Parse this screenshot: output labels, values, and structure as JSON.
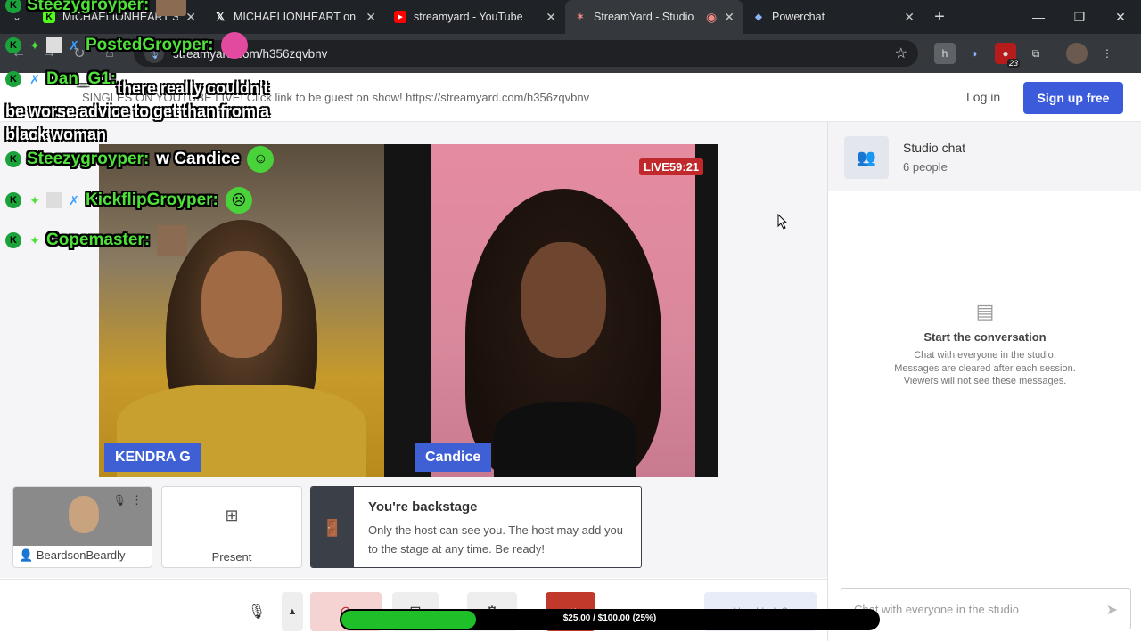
{
  "browser": {
    "tabs": [
      {
        "title": "MICHAELIONHEART Stre",
        "icon": "kick-icon",
        "color": "#53fc18"
      },
      {
        "title": "MICHAELIONHEART on X",
        "icon": "x-icon",
        "color": "#ffffff"
      },
      {
        "title": "streamyard - YouTube",
        "icon": "youtube-icon",
        "color": "#ff0000"
      },
      {
        "title": "StreamYard - Studio",
        "icon": "streamyard-icon",
        "color": "#f28b82",
        "active": true
      },
      {
        "title": "Powerchat",
        "icon": "powerchat-icon",
        "color": "#8ab4f8"
      }
    ],
    "url": "streamyard.com/h356zqvbnv"
  },
  "header": {
    "banner": "SINGLES ON YOUTUBE LIVE! Click link to be guest on show! https://streamyard.com/h356zqvbnv",
    "login": "Log in",
    "signup": "Sign up free"
  },
  "stage": {
    "live_label": "LIVE",
    "live_time": "59:21",
    "left_name": "KENDRA G",
    "right_name": "Candice"
  },
  "participant": {
    "name": "BeardsonBeardly"
  },
  "present": {
    "label": "Present"
  },
  "backstage": {
    "title": "You're backstage",
    "desc": "Only the host can see you. The host may add you to the stage at any time. Be ready!"
  },
  "controls": {
    "need_label": "Need help?"
  },
  "chat": {
    "title": "Studio chat",
    "people": "6 people",
    "empty_title": "Start the conversation",
    "empty_line1": "Chat with everyone in the studio.",
    "empty_line2": "Messages are cleared after each session.",
    "empty_line3": "Viewers will not see these messages.",
    "placeholder": "Chat with everyone in the studio"
  },
  "overlay": {
    "line0_name": "Steezygroyper:",
    "line1_name": "PostedGroyper:",
    "line2_name": "Dan_G1:",
    "line2_msg": "there really couldn't be worse advice to get than from a black woman",
    "line3_name": "Steezygroyper:",
    "line3_msg": "w Candice",
    "line4_name": "KickflipGroyper:",
    "line5_name": "Copemaster:"
  },
  "donation": {
    "text": "$25.00 / $100.00 (25%)",
    "progress": 0.25
  }
}
